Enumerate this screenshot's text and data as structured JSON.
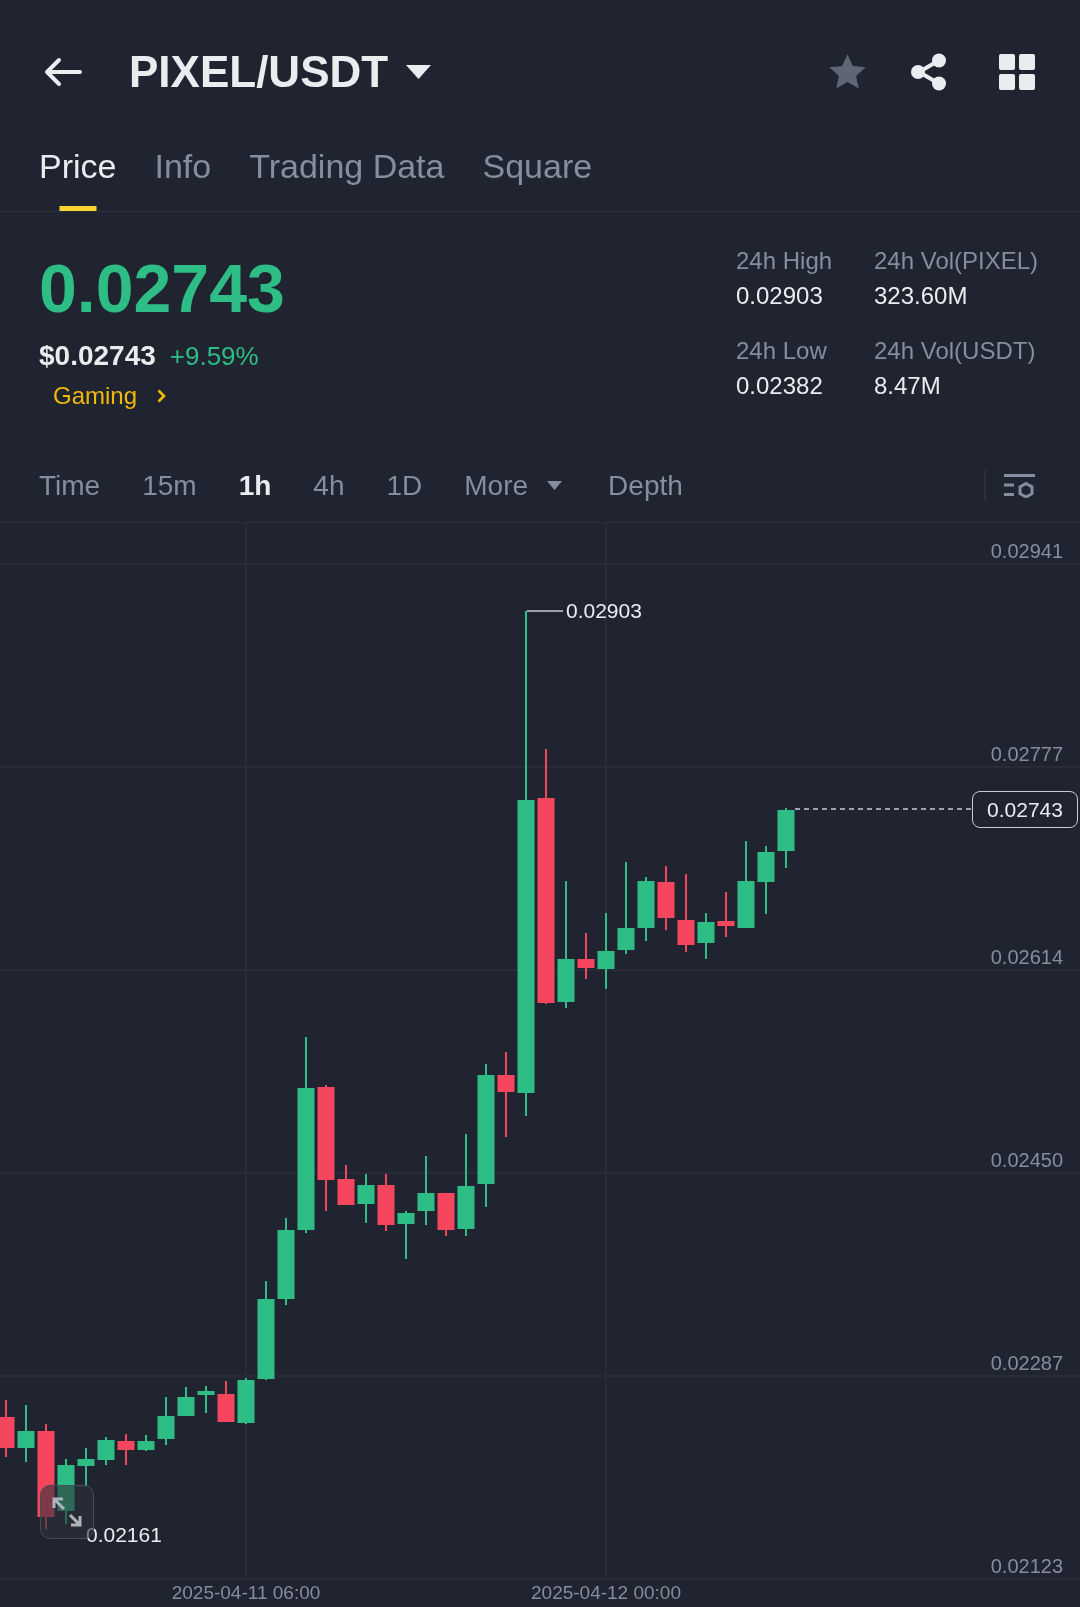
{
  "header": {
    "title": "PIXEL/USDT",
    "favorite": false
  },
  "tabs": [
    {
      "label": "Price",
      "selected": true
    },
    {
      "label": "Info",
      "selected": false
    },
    {
      "label": "Trading Data",
      "selected": false
    },
    {
      "label": "Square",
      "selected": false
    }
  ],
  "ticker": {
    "last_price": "0.02743",
    "usd_price": "$0.02743",
    "change": "+9.59%",
    "category": "Gaming"
  },
  "stats": [
    {
      "label": "24h High",
      "value": "0.02903"
    },
    {
      "label": "24h Vol(PIXEL)",
      "value": "323.60M"
    },
    {
      "label": "24h Low",
      "value": "0.02382"
    },
    {
      "label": "24h Vol(USDT)",
      "value": "8.47M"
    }
  ],
  "intervals": [
    {
      "label": "Time",
      "kind": "option",
      "selected": false
    },
    {
      "label": "15m",
      "kind": "option",
      "selected": false
    },
    {
      "label": "1h",
      "kind": "option",
      "selected": true
    },
    {
      "label": "4h",
      "kind": "option",
      "selected": false
    },
    {
      "label": "1D",
      "kind": "option",
      "selected": false
    },
    {
      "label": "More",
      "kind": "dropdown",
      "selected": false
    },
    {
      "label": "Depth",
      "kind": "option",
      "selected": false
    }
  ],
  "chart": {
    "price_axis": [
      "0.02941",
      "0.02777",
      "0.02614",
      "0.02450",
      "0.02287",
      "0.02123"
    ],
    "time_axis": [
      "2025-04-11 06:00",
      "2025-04-12 00:00"
    ],
    "high_marker": "0.02903",
    "low_marker": "0.02161",
    "last_price_tag": "0.02743"
  }
}
